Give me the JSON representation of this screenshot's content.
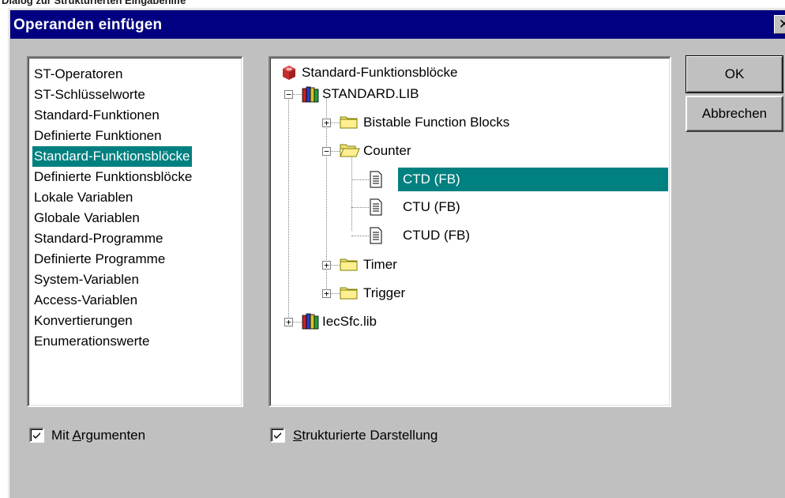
{
  "caption": "Dialog zur Strukturierten Eingabehilfe",
  "window": {
    "title": "Operanden einfügen",
    "close_glyph": "✕"
  },
  "category_list": {
    "items": [
      "ST-Operatoren",
      "ST-Schlüsselworte",
      "Standard-Funktionen",
      "Definierte Funktionen",
      "Standard-Funktionsblöcke",
      "Definierte Funktionsblöcke",
      "Lokale Variablen",
      "Globale Variablen",
      "Standard-Programme",
      "Definierte Programme",
      "System-Variablen",
      "Access-Variablen",
      "Konvertierungen",
      "Enumerationswerte"
    ],
    "selected": "Standard-Funktionsblöcke"
  },
  "tree": {
    "root": "Standard-Funktionsblöcke",
    "lib1": "STANDARD.LIB",
    "bistable": "Bistable Function Blocks",
    "counter": "Counter",
    "ctd": "CTD (FB)",
    "ctu": "CTU (FB)",
    "ctud": "CTUD (FB)",
    "timer": "Timer",
    "trigger": "Trigger",
    "lib2": "IecSfc.lib",
    "selected": "CTD (FB)"
  },
  "buttons": {
    "ok": "OK",
    "cancel": "Abbrechen"
  },
  "options": {
    "args_pre": "Mit ",
    "args_u": "A",
    "args_post": "rgumenten",
    "args_checked": true,
    "struct_u": "S",
    "struct_post": "trukturierte Darstellung",
    "struct_checked": true
  },
  "colors": {
    "title_bar": "#000080",
    "selection": "#008080",
    "face": "#c0c0c0"
  }
}
